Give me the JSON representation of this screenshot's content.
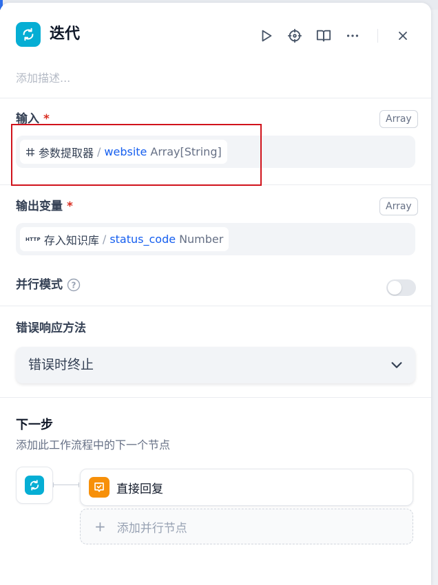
{
  "header": {
    "title": "迭代",
    "description_placeholder": "添加描述..."
  },
  "input": {
    "label": "输入",
    "required_mark": "*",
    "type_badge": "Array",
    "variable": {
      "source_node": "参数提取器",
      "separator": "/",
      "name": "website",
      "type": "Array[String]"
    }
  },
  "output": {
    "label": "输出变量",
    "required_mark": "*",
    "type_badge": "Array",
    "variable": {
      "source_tag": "HTTP",
      "source_node": "存入知识库",
      "separator": "/",
      "name": "status_code",
      "type": "Number"
    }
  },
  "parallel": {
    "label": "并行模式",
    "help_mark": "?",
    "enabled": false
  },
  "error_handling": {
    "label": "错误响应方法",
    "selected": "错误时终止"
  },
  "next_step": {
    "title": "下一步",
    "subtitle": "添加此工作流程中的下一个节点",
    "next_node_label": "直接回复",
    "add_parallel_plus": "+",
    "add_parallel_label": "添加并行节点"
  },
  "colors": {
    "iteration_icon": "#06aed4",
    "reply_icon": "#f79009",
    "variable_name": "#155eef",
    "required": "#d92d20",
    "highlight": "#d0121b"
  },
  "icons": [
    "iteration-icon",
    "play-icon",
    "locate-icon",
    "book-icon",
    "more-icon",
    "close-icon",
    "grid-icon",
    "help-icon",
    "chevron-down-icon",
    "reply-icon"
  ]
}
